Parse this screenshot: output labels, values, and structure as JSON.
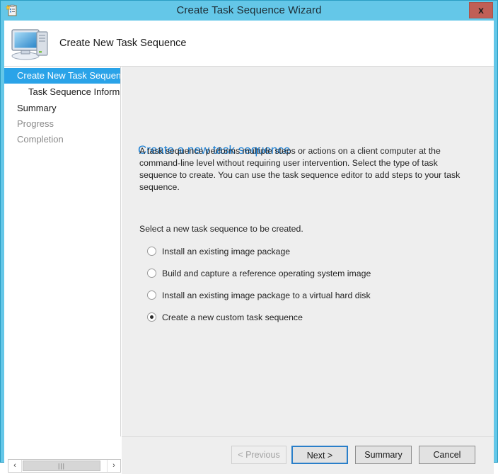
{
  "window": {
    "title": "Create Task Sequence Wizard",
    "icon": "task-sequence-clipboard-icon",
    "close_label": "x",
    "frame_color": "#64c7e8",
    "close_color": "#c05f56"
  },
  "banner": {
    "title": "Create New Task Sequence",
    "icon": "computer-icon"
  },
  "sidebar": {
    "items": [
      {
        "label": "Create New Task Sequence",
        "state": "active",
        "indent": false
      },
      {
        "label": "Task Sequence Informati",
        "state": "normal",
        "indent": true
      },
      {
        "label": "Summary",
        "state": "normal",
        "indent": false
      },
      {
        "label": "Progress",
        "state": "muted",
        "indent": false
      },
      {
        "label": "Completion",
        "state": "muted",
        "indent": false
      }
    ]
  },
  "main": {
    "page_title": "Create a new task sequence",
    "accent_color": "#1a7fd4",
    "body_text": "A task sequence performs multiple steps or actions on a client computer at the command-line level without requiring user intervention. Select the type of task sequence to create. You can use the task sequence editor to add steps to your task sequence.",
    "select_label": "Select a new task sequence to be created.",
    "options": [
      {
        "label": "Install an existing image package",
        "selected": false
      },
      {
        "label": "Build and capture a reference operating system image",
        "selected": false
      },
      {
        "label": "Install an existing image package to a virtual hard disk",
        "selected": false
      },
      {
        "label": "Create a new custom task sequence",
        "selected": true
      }
    ]
  },
  "buttons": {
    "previous": "< Previous",
    "next": "Next >",
    "summary": "Summary",
    "cancel": "Cancel"
  },
  "scrollbar": {
    "left_arrow": "‹",
    "right_arrow": "›",
    "grip": "|||"
  }
}
